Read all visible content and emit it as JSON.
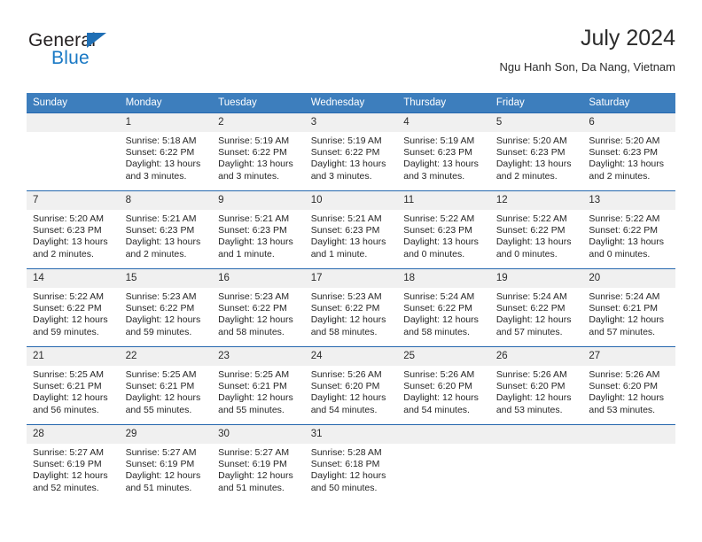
{
  "brand": {
    "name_top": "General",
    "name_bottom": "Blue",
    "triangle_color": "#1f6fb5",
    "blue_color": "#1878c4"
  },
  "header": {
    "title": "July 2024",
    "subtitle": "Ngu Hanh Son, Da Nang, Vietnam",
    "header_bg": "#3d7ebd",
    "row_border": "#2567ae",
    "daynum_bg": "#f0f0f0"
  },
  "weekday_headers": [
    "Sunday",
    "Monday",
    "Tuesday",
    "Wednesday",
    "Thursday",
    "Friday",
    "Saturday"
  ],
  "weeks": [
    [
      {
        "day": "",
        "sunrise": "",
        "sunset": "",
        "daylight1": "",
        "daylight2": ""
      },
      {
        "day": "1",
        "sunrise": "Sunrise: 5:18 AM",
        "sunset": "Sunset: 6:22 PM",
        "daylight1": "Daylight: 13 hours",
        "daylight2": "and 3 minutes."
      },
      {
        "day": "2",
        "sunrise": "Sunrise: 5:19 AM",
        "sunset": "Sunset: 6:22 PM",
        "daylight1": "Daylight: 13 hours",
        "daylight2": "and 3 minutes."
      },
      {
        "day": "3",
        "sunrise": "Sunrise: 5:19 AM",
        "sunset": "Sunset: 6:22 PM",
        "daylight1": "Daylight: 13 hours",
        "daylight2": "and 3 minutes."
      },
      {
        "day": "4",
        "sunrise": "Sunrise: 5:19 AM",
        "sunset": "Sunset: 6:23 PM",
        "daylight1": "Daylight: 13 hours",
        "daylight2": "and 3 minutes."
      },
      {
        "day": "5",
        "sunrise": "Sunrise: 5:20 AM",
        "sunset": "Sunset: 6:23 PM",
        "daylight1": "Daylight: 13 hours",
        "daylight2": "and 2 minutes."
      },
      {
        "day": "6",
        "sunrise": "Sunrise: 5:20 AM",
        "sunset": "Sunset: 6:23 PM",
        "daylight1": "Daylight: 13 hours",
        "daylight2": "and 2 minutes."
      }
    ],
    [
      {
        "day": "7",
        "sunrise": "Sunrise: 5:20 AM",
        "sunset": "Sunset: 6:23 PM",
        "daylight1": "Daylight: 13 hours",
        "daylight2": "and 2 minutes."
      },
      {
        "day": "8",
        "sunrise": "Sunrise: 5:21 AM",
        "sunset": "Sunset: 6:23 PM",
        "daylight1": "Daylight: 13 hours",
        "daylight2": "and 2 minutes."
      },
      {
        "day": "9",
        "sunrise": "Sunrise: 5:21 AM",
        "sunset": "Sunset: 6:23 PM",
        "daylight1": "Daylight: 13 hours",
        "daylight2": "and 1 minute."
      },
      {
        "day": "10",
        "sunrise": "Sunrise: 5:21 AM",
        "sunset": "Sunset: 6:23 PM",
        "daylight1": "Daylight: 13 hours",
        "daylight2": "and 1 minute."
      },
      {
        "day": "11",
        "sunrise": "Sunrise: 5:22 AM",
        "sunset": "Sunset: 6:23 PM",
        "daylight1": "Daylight: 13 hours",
        "daylight2": "and 0 minutes."
      },
      {
        "day": "12",
        "sunrise": "Sunrise: 5:22 AM",
        "sunset": "Sunset: 6:22 PM",
        "daylight1": "Daylight: 13 hours",
        "daylight2": "and 0 minutes."
      },
      {
        "day": "13",
        "sunrise": "Sunrise: 5:22 AM",
        "sunset": "Sunset: 6:22 PM",
        "daylight1": "Daylight: 13 hours",
        "daylight2": "and 0 minutes."
      }
    ],
    [
      {
        "day": "14",
        "sunrise": "Sunrise: 5:22 AM",
        "sunset": "Sunset: 6:22 PM",
        "daylight1": "Daylight: 12 hours",
        "daylight2": "and 59 minutes."
      },
      {
        "day": "15",
        "sunrise": "Sunrise: 5:23 AM",
        "sunset": "Sunset: 6:22 PM",
        "daylight1": "Daylight: 12 hours",
        "daylight2": "and 59 minutes."
      },
      {
        "day": "16",
        "sunrise": "Sunrise: 5:23 AM",
        "sunset": "Sunset: 6:22 PM",
        "daylight1": "Daylight: 12 hours",
        "daylight2": "and 58 minutes."
      },
      {
        "day": "17",
        "sunrise": "Sunrise: 5:23 AM",
        "sunset": "Sunset: 6:22 PM",
        "daylight1": "Daylight: 12 hours",
        "daylight2": "and 58 minutes."
      },
      {
        "day": "18",
        "sunrise": "Sunrise: 5:24 AM",
        "sunset": "Sunset: 6:22 PM",
        "daylight1": "Daylight: 12 hours",
        "daylight2": "and 58 minutes."
      },
      {
        "day": "19",
        "sunrise": "Sunrise: 5:24 AM",
        "sunset": "Sunset: 6:22 PM",
        "daylight1": "Daylight: 12 hours",
        "daylight2": "and 57 minutes."
      },
      {
        "day": "20",
        "sunrise": "Sunrise: 5:24 AM",
        "sunset": "Sunset: 6:21 PM",
        "daylight1": "Daylight: 12 hours",
        "daylight2": "and 57 minutes."
      }
    ],
    [
      {
        "day": "21",
        "sunrise": "Sunrise: 5:25 AM",
        "sunset": "Sunset: 6:21 PM",
        "daylight1": "Daylight: 12 hours",
        "daylight2": "and 56 minutes."
      },
      {
        "day": "22",
        "sunrise": "Sunrise: 5:25 AM",
        "sunset": "Sunset: 6:21 PM",
        "daylight1": "Daylight: 12 hours",
        "daylight2": "and 55 minutes."
      },
      {
        "day": "23",
        "sunrise": "Sunrise: 5:25 AM",
        "sunset": "Sunset: 6:21 PM",
        "daylight1": "Daylight: 12 hours",
        "daylight2": "and 55 minutes."
      },
      {
        "day": "24",
        "sunrise": "Sunrise: 5:26 AM",
        "sunset": "Sunset: 6:20 PM",
        "daylight1": "Daylight: 12 hours",
        "daylight2": "and 54 minutes."
      },
      {
        "day": "25",
        "sunrise": "Sunrise: 5:26 AM",
        "sunset": "Sunset: 6:20 PM",
        "daylight1": "Daylight: 12 hours",
        "daylight2": "and 54 minutes."
      },
      {
        "day": "26",
        "sunrise": "Sunrise: 5:26 AM",
        "sunset": "Sunset: 6:20 PM",
        "daylight1": "Daylight: 12 hours",
        "daylight2": "and 53 minutes."
      },
      {
        "day": "27",
        "sunrise": "Sunrise: 5:26 AM",
        "sunset": "Sunset: 6:20 PM",
        "daylight1": "Daylight: 12 hours",
        "daylight2": "and 53 minutes."
      }
    ],
    [
      {
        "day": "28",
        "sunrise": "Sunrise: 5:27 AM",
        "sunset": "Sunset: 6:19 PM",
        "daylight1": "Daylight: 12 hours",
        "daylight2": "and 52 minutes."
      },
      {
        "day": "29",
        "sunrise": "Sunrise: 5:27 AM",
        "sunset": "Sunset: 6:19 PM",
        "daylight1": "Daylight: 12 hours",
        "daylight2": "and 51 minutes."
      },
      {
        "day": "30",
        "sunrise": "Sunrise: 5:27 AM",
        "sunset": "Sunset: 6:19 PM",
        "daylight1": "Daylight: 12 hours",
        "daylight2": "and 51 minutes."
      },
      {
        "day": "31",
        "sunrise": "Sunrise: 5:28 AM",
        "sunset": "Sunset: 6:18 PM",
        "daylight1": "Daylight: 12 hours",
        "daylight2": "and 50 minutes."
      },
      {
        "day": "",
        "sunrise": "",
        "sunset": "",
        "daylight1": "",
        "daylight2": ""
      },
      {
        "day": "",
        "sunrise": "",
        "sunset": "",
        "daylight1": "",
        "daylight2": ""
      },
      {
        "day": "",
        "sunrise": "",
        "sunset": "",
        "daylight1": "",
        "daylight2": ""
      }
    ]
  ]
}
